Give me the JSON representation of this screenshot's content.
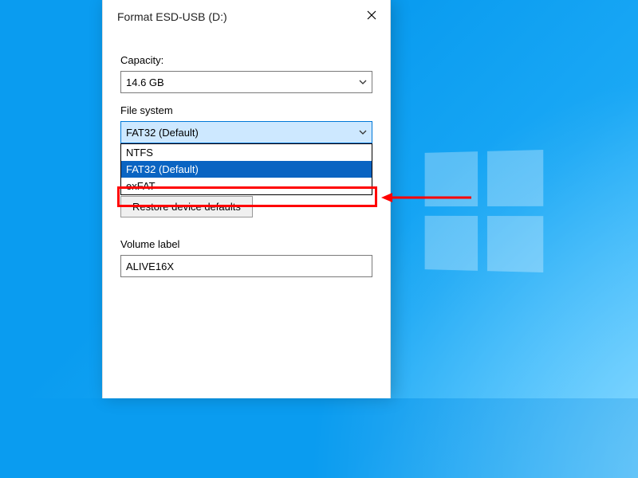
{
  "window": {
    "title": "Format ESD-USB (D:)"
  },
  "capacity": {
    "label": "Capacity:",
    "value": "14.6 GB"
  },
  "filesystem": {
    "label": "File system",
    "value": "FAT32 (Default)",
    "options": [
      "NTFS",
      "FAT32 (Default)",
      "exFAT"
    ]
  },
  "restore": {
    "label": "Restore device defaults"
  },
  "volume": {
    "label": "Volume label",
    "value": "ALIVE16X"
  }
}
